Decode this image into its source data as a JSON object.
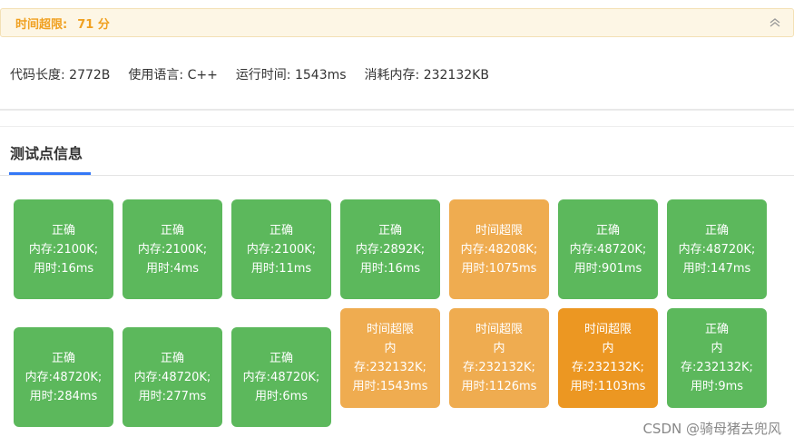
{
  "banner": {
    "label": "时间超限:",
    "score": "71 分"
  },
  "info": {
    "code_length": "代码长度: 2772B",
    "language": "使用语言: C++",
    "run_time": "运行时间: 1543ms",
    "memory": "消耗内存: 232132KB"
  },
  "section_title": "测试点信息",
  "testcases": [
    {
      "status": "正确",
      "mem": "内存:2100K;",
      "time": "用时:16ms",
      "kind": "ac"
    },
    {
      "status": "正确",
      "mem": "内存:2100K;",
      "time": "用时:4ms",
      "kind": "ac"
    },
    {
      "status": "正确",
      "mem": "内存:2100K;",
      "time": "用时:11ms",
      "kind": "ac"
    },
    {
      "status": "正确",
      "mem": "内存:2892K;",
      "time": "用时:16ms",
      "kind": "ac"
    },
    {
      "status": "时间超限",
      "mem": "内存:48208K;",
      "time": "用时:1075ms",
      "kind": "tle"
    },
    {
      "status": "正确",
      "mem": "内存:48720K;",
      "time": "用时:901ms",
      "kind": "ac"
    },
    {
      "status": "正确",
      "mem": "内存:48720K;",
      "time": "用时:147ms",
      "kind": "ac"
    },
    {
      "status": "正确",
      "mem": "内存:48720K;",
      "time": "用时:284ms",
      "kind": "ac"
    },
    {
      "status": "正确",
      "mem": "内存:48720K;",
      "time": "用时:277ms",
      "kind": "ac"
    },
    {
      "status": "正确",
      "mem": "内存:48720K;",
      "time": "用时:6ms",
      "kind": "ac"
    },
    {
      "status": "时间超限",
      "mem1": "内",
      "mem2": "存:232132K;",
      "time": "用时:1543ms",
      "kind": "tle"
    },
    {
      "status": "时间超限",
      "mem1": "内",
      "mem2": "存:232132K;",
      "time": "用时:1126ms",
      "kind": "tle"
    },
    {
      "status": "时间超限",
      "mem1": "内",
      "mem2": "存:232132K;",
      "time": "用时:1103ms",
      "kind": "tle2"
    },
    {
      "status": "正确",
      "mem1": "内",
      "mem2": "存:232132K;",
      "time": "用时:9ms",
      "kind": "ac"
    }
  ],
  "watermark": "CSDN @骑母猪去兜风",
  "colors": {
    "accepted": "#5cb85c",
    "time_limit": "#efac50",
    "time_limit_selected": "#ec9722",
    "tab_underline": "#3478f6"
  }
}
